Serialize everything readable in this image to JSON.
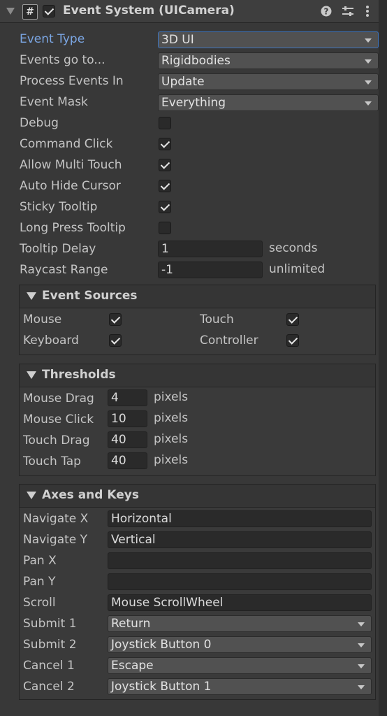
{
  "header": {
    "title": "Event System (UICamera)",
    "script_glyph": "#",
    "enabled": true,
    "help_icon": "help-icon",
    "presets_icon": "presets-icon",
    "menu_icon": "kebab-menu-icon"
  },
  "fields": {
    "event_type": {
      "label": "Event Type",
      "value": "3D UI"
    },
    "events_go_to": {
      "label": "Events go to...",
      "value": "Rigidbodies"
    },
    "process_events_in": {
      "label": "Process Events In",
      "value": "Update"
    },
    "event_mask": {
      "label": "Event Mask",
      "value": "Everything"
    },
    "debug": {
      "label": "Debug",
      "checked": false
    },
    "command_click": {
      "label": "Command Click",
      "checked": true
    },
    "allow_multi_touch": {
      "label": "Allow Multi Touch",
      "checked": true
    },
    "auto_hide_cursor": {
      "label": "Auto Hide Cursor",
      "checked": true
    },
    "sticky_tooltip": {
      "label": "Sticky Tooltip",
      "checked": true
    },
    "long_press_tooltip": {
      "label": "Long Press Tooltip",
      "checked": false
    },
    "tooltip_delay": {
      "label": "Tooltip Delay",
      "value": "1",
      "unit": "seconds"
    },
    "raycast_range": {
      "label": "Raycast Range",
      "value": "-1",
      "unit": "unlimited"
    }
  },
  "event_sources": {
    "title": "Event Sources",
    "mouse": {
      "label": "Mouse",
      "checked": true
    },
    "touch": {
      "label": "Touch",
      "checked": true
    },
    "keyboard": {
      "label": "Keyboard",
      "checked": true
    },
    "controller": {
      "label": "Controller",
      "checked": true
    }
  },
  "thresholds": {
    "title": "Thresholds",
    "mouse_drag": {
      "label": "Mouse Drag",
      "value": "4",
      "unit": "pixels"
    },
    "mouse_click": {
      "label": "Mouse Click",
      "value": "10",
      "unit": "pixels"
    },
    "touch_drag": {
      "label": "Touch Drag",
      "value": "40",
      "unit": "pixels"
    },
    "touch_tap": {
      "label": "Touch Tap",
      "value": "40",
      "unit": "pixels"
    }
  },
  "axes": {
    "title": "Axes and Keys",
    "navigate_x": {
      "label": "Navigate X",
      "value": "Horizontal"
    },
    "navigate_y": {
      "label": "Navigate Y",
      "value": "Vertical"
    },
    "pan_x": {
      "label": "Pan X",
      "value": ""
    },
    "pan_y": {
      "label": "Pan Y",
      "value": ""
    },
    "scroll": {
      "label": "Scroll",
      "value": "Mouse ScrollWheel"
    },
    "submit_1": {
      "label": "Submit 1",
      "value": "Return"
    },
    "submit_2": {
      "label": "Submit 2",
      "value": "Joystick Button 0"
    },
    "cancel_1": {
      "label": "Cancel 1",
      "value": "Escape"
    },
    "cancel_2": {
      "label": "Cancel 2",
      "value": "Joystick Button 1"
    }
  },
  "colors": {
    "background": "#383838",
    "focus_accent": "#3d75c0",
    "active_label": "#7ba6e3"
  }
}
